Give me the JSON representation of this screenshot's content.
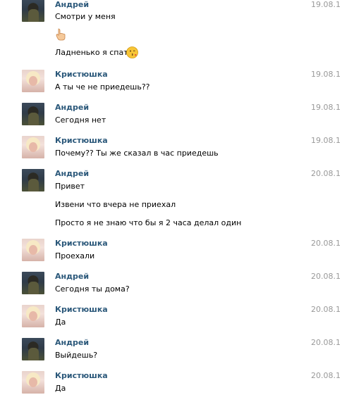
{
  "messages": [
    {
      "author": "Андрей",
      "date": "19.08.1",
      "avatar": "andrey-avatar",
      "lines": [
        "Смотри у меня",
        "",
        "Ладненько я спать"
      ],
      "emoji": [
        "pointing-hand-icon",
        "kiss-face-icon"
      ]
    },
    {
      "author": "Кристюшка",
      "date": "19.08.1",
      "avatar": "kristina-avatar",
      "lines": [
        "А ты че не приедешь??"
      ]
    },
    {
      "author": "Андрей",
      "date": "19.08.1",
      "avatar": "andrey-avatar",
      "lines": [
        "Сегодня нет"
      ]
    },
    {
      "author": "Кристюшка",
      "date": "19.08.1",
      "avatar": "kristina-avatar",
      "lines": [
        "Почему?? Ты же сказал в час приедешь"
      ]
    },
    {
      "author": "Андрей",
      "date": "20.08.1",
      "avatar": "andrey-avatar",
      "lines": [
        "Привет",
        "Извени что вчера не приехал",
        "Просто я не знаю что бы я 2 часа делал один"
      ]
    },
    {
      "author": "Кристюшка",
      "date": "20.08.1",
      "avatar": "kristina-avatar",
      "lines": [
        "Проехали"
      ]
    },
    {
      "author": "Андрей",
      "date": "20.08.1",
      "avatar": "andrey-avatar",
      "lines": [
        "Сегодня ты дома?"
      ]
    },
    {
      "author": "Кристюшка",
      "date": "20.08.1",
      "avatar": "kristina-avatar",
      "lines": [
        "Да"
      ]
    },
    {
      "author": "Андрей",
      "date": "20.08.1",
      "avatar": "andrey-avatar",
      "lines": [
        "Выйдешь?"
      ]
    },
    {
      "author": "Кристюшка",
      "date": "20.08.1",
      "avatar": "kristina-avatar",
      "lines": [
        "Да"
      ]
    }
  ]
}
